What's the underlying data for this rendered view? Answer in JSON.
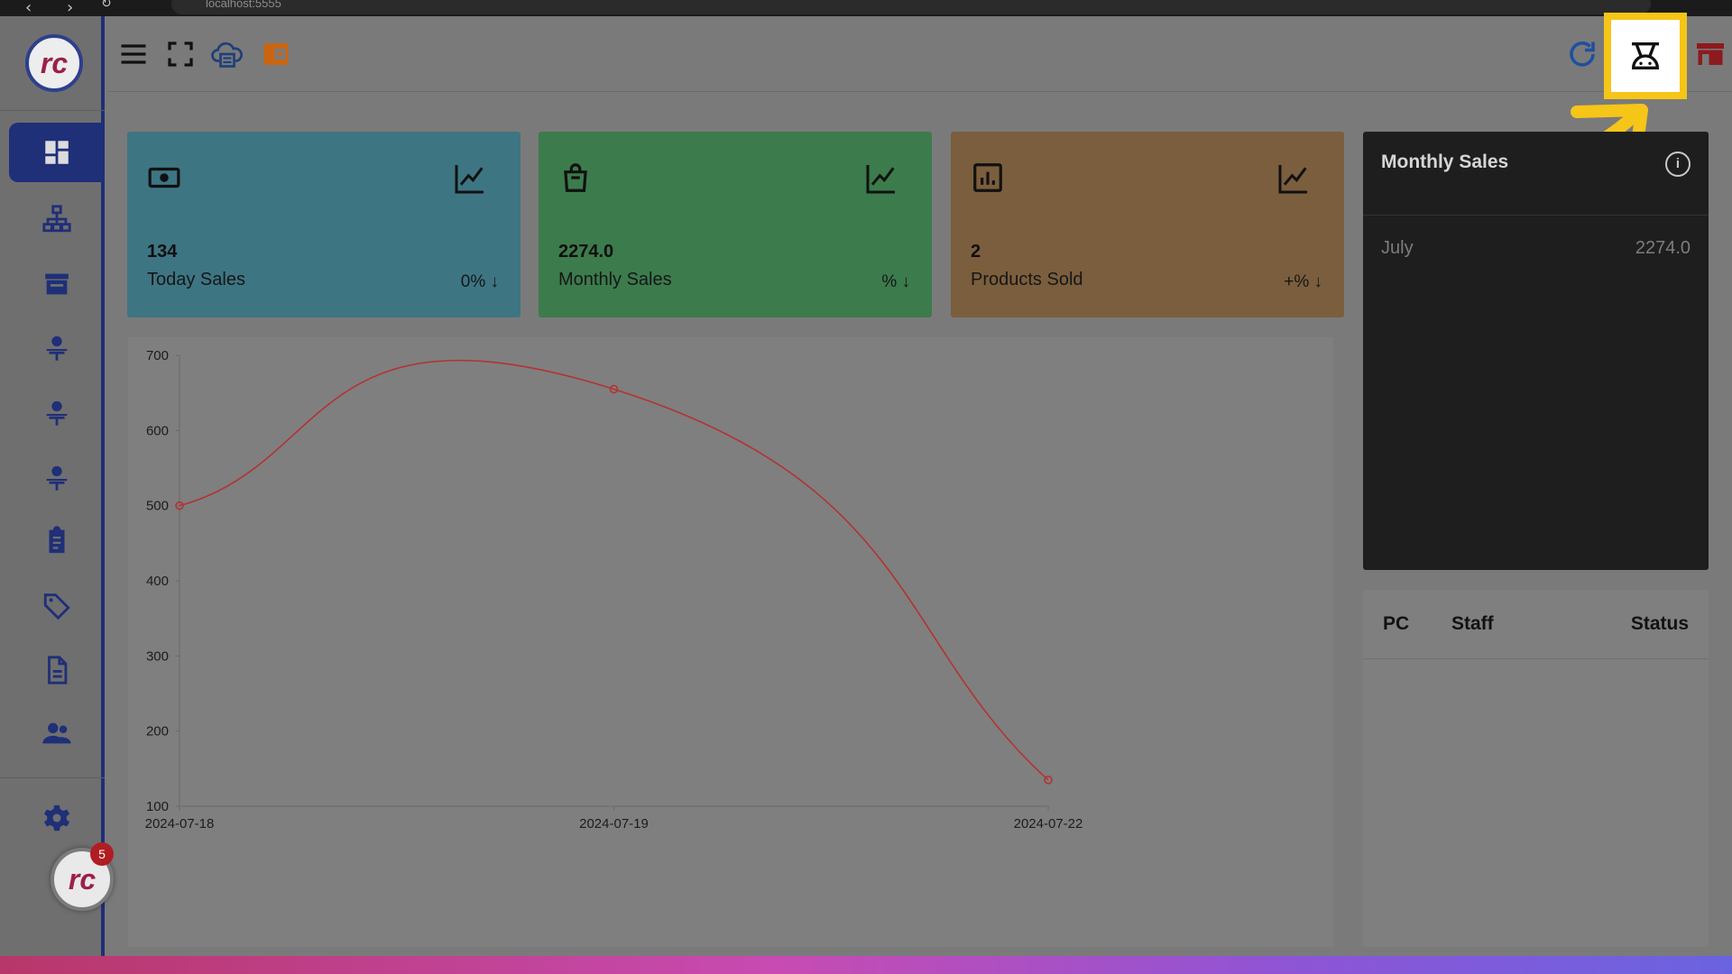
{
  "browser": {
    "url": "localhost:5555"
  },
  "sidebar": {
    "logo_text": "rc",
    "items": [
      {
        "icon": "dashboard-icon",
        "active": true
      },
      {
        "icon": "hierarchy-icon"
      },
      {
        "icon": "store-icon"
      },
      {
        "icon": "person-desk-icon"
      },
      {
        "icon": "person-desk-icon"
      },
      {
        "icon": "person-desk-icon"
      },
      {
        "icon": "clipboard-icon"
      },
      {
        "icon": "tag-icon"
      },
      {
        "icon": "document-icon"
      },
      {
        "icon": "users-icon"
      },
      {
        "icon": "gear-icon"
      }
    ],
    "notification_count": "5"
  },
  "header": {
    "left_icons": [
      "menu-icon",
      "fullscreen-icon",
      "cloud-print-icon",
      "wallet-icon"
    ],
    "right_icons": [
      "refresh-icon",
      "cash-register-icon",
      "shop-icon"
    ]
  },
  "cards": [
    {
      "value": "134",
      "label": "Today Sales",
      "change": "0% ↓",
      "color": "#3d7583",
      "icon": "cash-icon"
    },
    {
      "value": "2274.0",
      "label": "Monthly Sales",
      "change": "% ↓",
      "color": "#3c7b4c",
      "icon": "bag-icon"
    },
    {
      "value": "2",
      "label": "Products Sold",
      "change": "+% ↓",
      "color": "#7b5e3d",
      "icon": "bar-chart-icon"
    }
  ],
  "monthly_sales": {
    "title": "Monthly Sales",
    "rows": [
      {
        "month": "July",
        "value": "2274.0"
      }
    ]
  },
  "staff_table": {
    "headers": [
      "PC",
      "Staff",
      "Status"
    ]
  },
  "chart_data": {
    "type": "line",
    "x": [
      "2024-07-18",
      "2024-07-19",
      "2024-07-22"
    ],
    "series": [
      {
        "values": [
          500,
          655,
          135
        ],
        "color": "#b43232"
      }
    ],
    "yticks": [
      100,
      200,
      300,
      400,
      500,
      600,
      700
    ],
    "ylim": [
      100,
      700
    ],
    "smooth": true
  }
}
